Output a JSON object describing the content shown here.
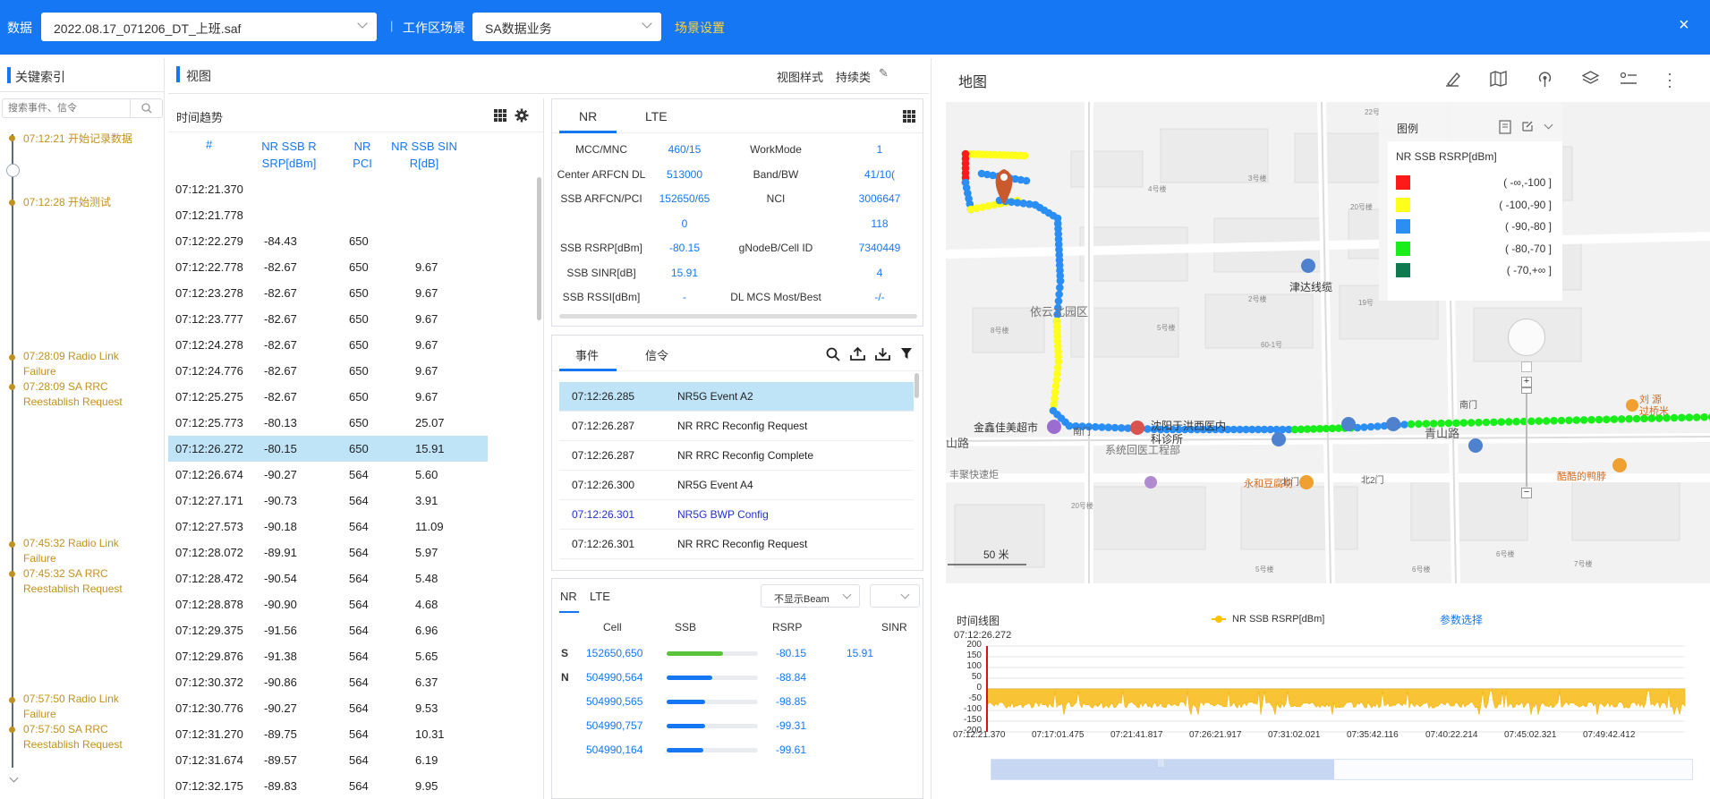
{
  "topbar": {
    "data_label": "数据",
    "file_value": "2022.08.17_071206_DT_上班.saf",
    "scene_label": "工作区场景",
    "scene_value": "SA数据业务",
    "scene_settings": "场景设置",
    "close": "×",
    "colors": {
      "bar": "#1677f5",
      "accent": "#ffd43b"
    }
  },
  "index": {
    "title": "关键索引",
    "search_placeholder": "搜索事件、信令",
    "events": [
      {
        "text": "07:12:21 开始记录数据"
      },
      {
        "text": "07:12:28 开始测试"
      },
      {
        "text": "07:28:09 Radio Link Failure"
      },
      {
        "text": "07:28:09 SA RRC Reestablish Request"
      },
      {
        "text": "07:45:32 Radio Link Failure"
      },
      {
        "text": "07:45:32 SA RRC Reestablish Request"
      },
      {
        "text": "07:57:50 Radio Link Failure"
      },
      {
        "text": "07:57:50 SA RRC Reestablish Request"
      }
    ]
  },
  "view": {
    "title": "视图",
    "view_style": "视图样式",
    "persist": "持续类"
  },
  "trend": {
    "title": "时间趋势",
    "headers": [
      "#",
      "NR SSB RSRP[dBm]",
      "NR PCI",
      "NR SSB SINR[dB]"
    ],
    "rows": [
      [
        "07:12:21.370",
        "",
        "",
        ""
      ],
      [
        "07:12:21.778",
        "",
        "",
        ""
      ],
      [
        "07:12:22.279",
        "-84.43",
        "650",
        ""
      ],
      [
        "07:12:22.778",
        "-82.67",
        "650",
        "9.67"
      ],
      [
        "07:12:23.278",
        "-82.67",
        "650",
        "9.67"
      ],
      [
        "07:12:23.777",
        "-82.67",
        "650",
        "9.67"
      ],
      [
        "07:12:24.278",
        "-82.67",
        "650",
        "9.67"
      ],
      [
        "07:12:24.776",
        "-82.67",
        "650",
        "9.67"
      ],
      [
        "07:12:25.275",
        "-82.67",
        "650",
        "9.67"
      ],
      [
        "07:12:25.773",
        "-80.13",
        "650",
        "25.07"
      ],
      [
        "07:12:26.272",
        "-80.15",
        "650",
        "15.91"
      ],
      [
        "07:12:26.674",
        "-90.27",
        "564",
        "5.60"
      ],
      [
        "07:12:27.171",
        "-90.73",
        "564",
        "3.91"
      ],
      [
        "07:12:27.573",
        "-90.18",
        "564",
        "11.09"
      ],
      [
        "07:12:28.072",
        "-89.91",
        "564",
        "5.97"
      ],
      [
        "07:12:28.472",
        "-90.54",
        "564",
        "5.48"
      ],
      [
        "07:12:28.878",
        "-90.90",
        "564",
        "4.68"
      ],
      [
        "07:12:29.375",
        "-91.56",
        "564",
        "6.96"
      ],
      [
        "07:12:29.876",
        "-91.38",
        "564",
        "5.65"
      ],
      [
        "07:12:30.372",
        "-90.86",
        "564",
        "6.37"
      ],
      [
        "07:12:30.776",
        "-90.27",
        "564",
        "9.53"
      ],
      [
        "07:12:31.270",
        "-89.75",
        "564",
        "10.31"
      ],
      [
        "07:12:31.674",
        "-89.57",
        "564",
        "6.19"
      ],
      [
        "07:12:32.175",
        "-89.83",
        "564",
        "9.95"
      ]
    ],
    "selected_index": 10
  },
  "nrinfo": {
    "tabs": [
      "NR",
      "LTE"
    ],
    "rows": [
      [
        "MCC/MNC",
        "460/15",
        "WorkMode",
        "1"
      ],
      [
        "Center ARFCN DL",
        "513000",
        "Band/BW",
        "41/10("
      ],
      [
        "SSB ARFCN/PCI",
        "152650/65",
        "NCI",
        "3006647"
      ],
      [
        "",
        "0",
        "",
        "118"
      ],
      [
        "SSB RSRP[dBm]",
        "-80.15",
        "gNodeB/Cell ID",
        "7340449"
      ],
      [
        "SSB SINR[dB]",
        "15.91",
        "",
        "4"
      ],
      [
        "SSB RSSI[dBm]",
        "-",
        "DL MCS Most/Best",
        "-/-"
      ]
    ]
  },
  "events": {
    "tabs": [
      "事件",
      "信令"
    ],
    "rows": [
      [
        "07:12:26.285",
        "NR5G Event A2"
      ],
      [
        "07:12:26.287",
        "NR RRC Reconfig Request"
      ],
      [
        "07:12:26.287",
        "NR RRC Reconfig Complete"
      ],
      [
        "07:12:26.300",
        "NR5G Event A4"
      ],
      [
        "07:12:26.301",
        "NR5G BWP Config"
      ],
      [
        "07:12:26.301",
        "NR RRC Reconfig Request"
      ]
    ]
  },
  "cells": {
    "tabs": [
      "NR",
      "LTE"
    ],
    "beam_select": "不显示Beam",
    "headers": [
      "Cell",
      "SSB",
      "RSRP",
      "SINR"
    ],
    "rows": [
      {
        "tag": "S",
        "cell": "152650,650",
        "level": 0.62,
        "rsrp": "-80.15",
        "sinr": "15.91"
      },
      {
        "tag": "N",
        "cell": "504990,564",
        "level": 0.5,
        "rsrp": "-88.84",
        "sinr": ""
      },
      {
        "tag": "",
        "cell": "504990,565",
        "level": 0.42,
        "rsrp": "-98.85",
        "sinr": ""
      },
      {
        "tag": "",
        "cell": "504990,757",
        "level": 0.42,
        "rsrp": "-99.31",
        "sinr": ""
      },
      {
        "tag": "",
        "cell": "504990,164",
        "level": 0.4,
        "rsrp": "-99.61",
        "sinr": ""
      }
    ]
  },
  "map": {
    "title": "地图",
    "legend_title": "图例",
    "legend_subtitle": "NR SSB RSRP[dBm]",
    "legend": [
      {
        "color": "#ff1a1a",
        "label": "( -∞,-100 ]"
      },
      {
        "color": "#ffff1a",
        "label": "( -100,-90 ]"
      },
      {
        "color": "#2a8ef5",
        "label": "( -90,-80 ]"
      },
      {
        "color": "#1aee1a",
        "label": "( -80,-70 ]"
      },
      {
        "color": "#0d7a50",
        "label": "( -70,+∞ ]"
      }
    ],
    "labels": {
      "yiyun": "依云北园区",
      "jinxin": "金鑫佳美超市",
      "shenyang": "沈阳于洪西医内科诊所",
      "jinda": "津达线缆",
      "qingshan": "青山路",
      "shan": "山路",
      "fengchan": "丰聚快速炬",
      "yonghe": "永和豆腐坊",
      "kuku": "酷酷的鸭脖",
      "beimen": "北门",
      "beimen2": "北2门",
      "nanmen": "南门",
      "nanmen2": "南门",
      "liu": "刘 源过桥米",
      "scale": "50 米",
      "xitong": "系统回医工程部",
      "b4": "4号楼",
      "b3": "3号楼",
      "b5": "5号楼",
      "b2": "2号楼",
      "b20": "20号楼",
      "b19": "19号",
      "b22": "22号",
      "b20b": "20号楼",
      "b5b": "5号楼",
      "b6": "6号楼",
      "b7": "7号楼",
      "b8": "8号楼",
      "b6b": "6号楼",
      "b601": "60-1号"
    }
  },
  "timeline": {
    "title": "时间线图",
    "legend": "NR SSB RSRP[dBm]",
    "param": "参数选择",
    "cursor_time": "07:12:26.272",
    "y_ticks": [
      "200",
      "150",
      "100",
      "50",
      "0",
      "-50",
      "-100",
      "-150",
      "-200"
    ],
    "x_ticks": [
      "07:12:21.370",
      "07:17:01.475",
      "07:21:41.817",
      "07:26:21.917",
      "07:31:02.021",
      "07:35:42.116",
      "07:40:22.214",
      "07:45:02.321",
      "07:49:42.412"
    ]
  }
}
